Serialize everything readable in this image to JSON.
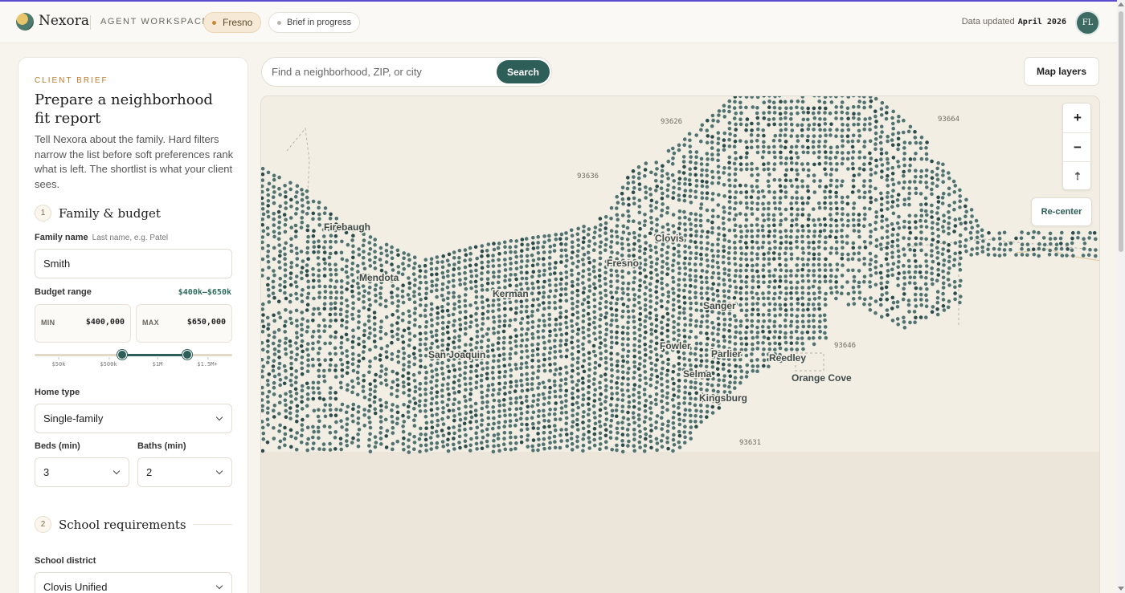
{
  "header": {
    "brand": "Nexora",
    "workspace": "AGENT WORKSPACE",
    "city": "Fresno",
    "status": "Brief in progress",
    "updated_label": "Data updated",
    "updated_value": "April 2026",
    "avatar": "FL"
  },
  "brief": {
    "eyebrow": "CLIENT BRIEF",
    "title": "Prepare a neighborhood fit report",
    "intro": "Tell Nexora about the family. Hard filters narrow the list before soft preferences rank what is left. The shortlist is what your client sees.",
    "step1": {
      "num": "1",
      "label": "Family & budget"
    },
    "family_label": "Family name",
    "family_hint": "Last name, e.g. Patel",
    "family_value": "Smith",
    "budget_label": "Budget range",
    "budget_value": "$400k–$650k",
    "min_label": "MIN",
    "min_value": "$400,000",
    "max_label": "MAX",
    "max_value": "$650,000",
    "slider": {
      "min": 400000,
      "max": 650000,
      "range_min": 50000,
      "range_max": 1500000
    },
    "ticks": [
      "$50k",
      "$500k",
      "$1M",
      "$1.5M+"
    ],
    "home_type_label": "Home type",
    "home_type_value": "Single-family",
    "beds_label": "Beds (min)",
    "beds_value": "3",
    "baths_label": "Baths (min)",
    "baths_value": "2",
    "step2": {
      "num": "2",
      "label": "School requirements"
    },
    "district_label": "School district",
    "district_value": "Clovis Unified"
  },
  "map": {
    "search_placeholder": "Find a neighborhood, ZIP, or city",
    "search_button": "Search",
    "layers_button": "Map layers",
    "zoom_in": "+",
    "zoom_out": "−",
    "reset_north": "⇡",
    "recenter": "Re-center",
    "cities": [
      "Firebaugh",
      "Clovis",
      "Fresno",
      "Mendota",
      "Kerman",
      "Sanger",
      "San Joaquin",
      "Fowler",
      "Parlier",
      "Reedley",
      "Orange Cove",
      "Selma",
      "Kingsburg"
    ],
    "zips": [
      "93626",
      "93664",
      "93636",
      "93646",
      "93631"
    ],
    "colors": {
      "dot": "#54716d",
      "dot_dark": "#2f4a47",
      "accent": "#2e5e58"
    }
  }
}
